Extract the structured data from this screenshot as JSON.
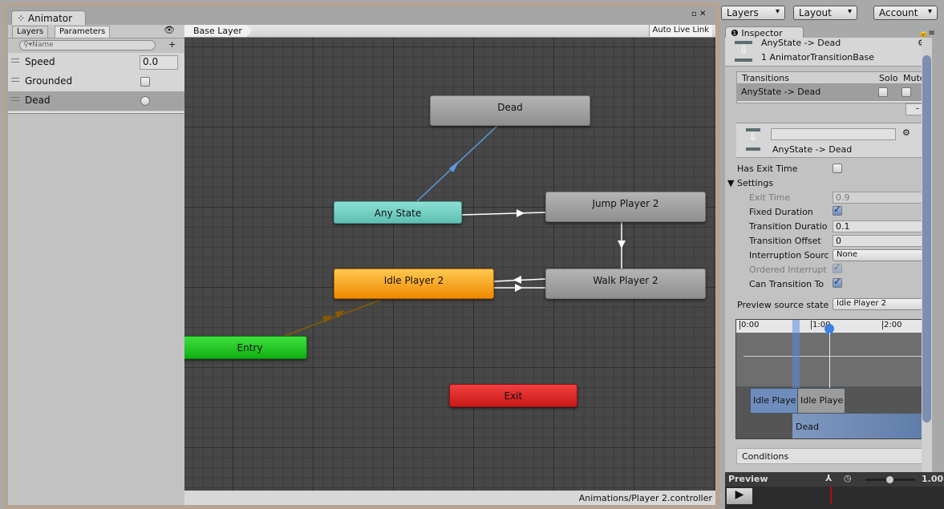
{
  "animator": {
    "tab": "Animator",
    "left_tabs": [
      "Layers",
      "Parameters"
    ],
    "search_placeholder": "Name",
    "parameters": [
      {
        "name": "Speed",
        "type": "float",
        "value": "0.0"
      },
      {
        "name": "Grounded",
        "type": "bool",
        "value": false
      },
      {
        "name": "Dead",
        "type": "trigger",
        "selected": true
      }
    ],
    "breadcrumb": "Base Layer",
    "auto_live_link": "Auto Live Link",
    "states": {
      "dead": "Dead",
      "any_state": "Any State",
      "jump": "Jump Player 2",
      "idle": "Idle Player 2",
      "walk": "Walk Player 2",
      "entry": "Entry",
      "exit": "Exit"
    },
    "status_path": "Animations/Player 2.controller",
    "colors": {
      "any_state": "#6cc7bb",
      "default_state": "#f39c12",
      "entry": "#1fc21f",
      "exit": "#d42121",
      "transition_selected": "#5b9be0"
    }
  },
  "toolbar": {
    "layers": "Layers",
    "layout": "Layout",
    "account": "Account"
  },
  "inspector": {
    "tab": "Inspector",
    "title": "AnyState -> Dead",
    "subtitle": "1 AnimatorTransitionBase",
    "transitions_header": "Transitions",
    "solo": "Solo",
    "mute": "Mute",
    "transition_row": "AnyState -> Dead",
    "remove": "–",
    "transition_name": "AnyState -> Dead",
    "name_field": "",
    "has_exit_time": {
      "label": "Has Exit Time",
      "checked": false
    },
    "settings": "Settings",
    "exit_time": {
      "label": "Exit Time",
      "value": "0.9"
    },
    "fixed_duration": {
      "label": "Fixed Duration",
      "checked": true
    },
    "transition_duration": {
      "label": "Transition Duratio",
      "value": "0.1"
    },
    "transition_offset": {
      "label": "Transition Offset",
      "value": "0"
    },
    "interruption_source": {
      "label": "Interruption Sourc",
      "value": "None"
    },
    "ordered_interruption": {
      "label": "Ordered Interrupt",
      "checked": true
    },
    "can_transition_to_self": {
      "label": "Can Transition To",
      "checked": true
    },
    "preview_source_state": {
      "label": "Preview source state",
      "value": "Idle Player 2"
    },
    "timeline": {
      "ticks": [
        "0:00",
        "1:00",
        "2:00"
      ],
      "clip_a": "Idle Playe",
      "clip_b": "Idle Playe",
      "clip_dead": "Dead"
    },
    "conditions": "Conditions"
  },
  "preview": {
    "label": "Preview",
    "speed": "1.00"
  }
}
